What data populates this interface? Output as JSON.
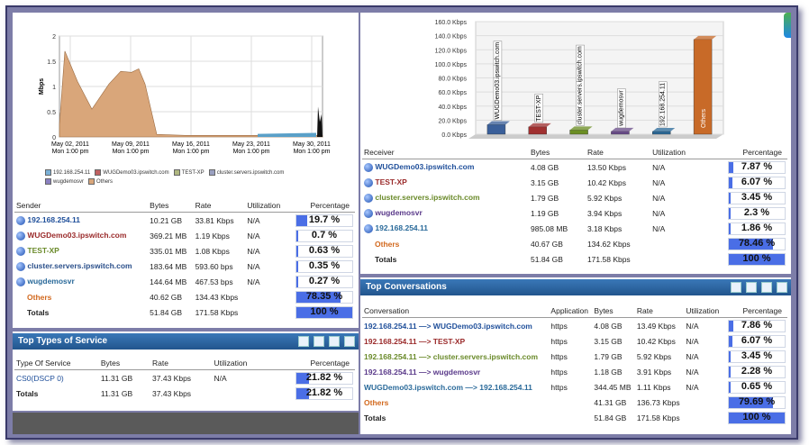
{
  "colors": {
    "header_blue": "#2a64a0",
    "bar_blue": "#4a6ee6",
    "others_orange": "#d2691e",
    "area_tan": "#d9a67a"
  },
  "sender_chart": {
    "y_ticks": [
      "2",
      "1.5",
      "1",
      "0.5",
      "0"
    ],
    "y_label": "Mbps",
    "x_ticks": [
      {
        "line1": "May 02, 2011",
        "line2": "Mon 1:00 pm"
      },
      {
        "line1": "May 09, 2011",
        "line2": "Mon 1:00 pm"
      },
      {
        "line1": "May 16, 2011",
        "line2": "Mon 1:00 pm"
      },
      {
        "line1": "May 23, 2011",
        "line2": "Mon 1:00 pm"
      },
      {
        "line1": "May 30, 2011",
        "line2": "Mon 1:00 pm"
      }
    ],
    "legend": [
      "192.168.254.11",
      "WUGDemo03.ipswitch.com",
      "TEST-XP",
      "cluster.servers.ipswitch.com",
      "wugdemosvr",
      "Others"
    ]
  },
  "sender_table": {
    "headers": [
      "Sender",
      "Bytes",
      "Rate",
      "Utilization",
      "Percentage"
    ],
    "rows": [
      {
        "name": "192.168.254.11",
        "bytes": "10.21 GB",
        "rate": "33.81 Kbps",
        "util": "N/A",
        "pct": "19.7 %",
        "frac": 0.197,
        "color": "#1f4f9a"
      },
      {
        "name": "WUGDemo03.ipswitch.com",
        "bytes": "369.21 MB",
        "rate": "1.19 Kbps",
        "util": "N/A",
        "pct": "0.7 %",
        "frac": 0.007,
        "color": "#9a2a2a"
      },
      {
        "name": "TEST-XP",
        "bytes": "335.01 MB",
        "rate": "1.08 Kbps",
        "util": "N/A",
        "pct": "0.63 %",
        "frac": 0.0063,
        "color": "#6a8a2a"
      },
      {
        "name": "cluster.servers.ipswitch.com",
        "bytes": "183.64 MB",
        "rate": "593.60 bps",
        "util": "N/A",
        "pct": "0.35 %",
        "frac": 0.0035,
        "color": "#2a4f8a"
      },
      {
        "name": "wugdemosvr",
        "bytes": "144.64 MB",
        "rate": "467.53 bps",
        "util": "N/A",
        "pct": "0.27 %",
        "frac": 0.0027,
        "color": "#2a6a9a"
      }
    ],
    "others": {
      "name": "Others",
      "bytes": "40.62 GB",
      "rate": "134.43 Kbps",
      "util": "N/A",
      "pct": "78.35 %",
      "frac": 0.7835
    },
    "totals": {
      "name": "Totals",
      "bytes": "51.84 GB",
      "rate": "171.58 Kbps",
      "util": "N/A",
      "pct": "100 %",
      "frac": 1.0
    }
  },
  "tos": {
    "title": "Top Types of Service",
    "headers": [
      "Type Of Service",
      "Bytes",
      "Rate",
      "Utilization",
      "Percentage"
    ],
    "row": {
      "name": "CS0(DSCP 0)",
      "bytes": "11.31 GB",
      "rate": "37.43 Kbps",
      "util": "N/A",
      "pct": "21.82 %",
      "frac": 0.2182
    },
    "totals": {
      "name": "Totals",
      "bytes": "11.31 GB",
      "rate": "37.43 Kbps",
      "util": "N/A",
      "pct": "21.82 %",
      "frac": 0.2182
    }
  },
  "receiver_chart": {
    "y_ticks": [
      "160.0 Kbps",
      "140.0 Kbps",
      "120.0 Kbps",
      "100.0 Kbps",
      "80.0 Kbps",
      "60.0 Kbps",
      "40.0 Kbps",
      "20.0 Kbps",
      "0.0 Kbps"
    ],
    "bars": [
      {
        "label": "WUGDemo03.ipswitch.com",
        "value": 13.5,
        "color": "#3a5f9a"
      },
      {
        "label": "TEST-XP",
        "value": 10.42,
        "color": "#a03030"
      },
      {
        "label": "cluster.servers.ipswitch.com",
        "value": 5.92,
        "color": "#6b8e23"
      },
      {
        "label": "wugdemosvr",
        "value": 3.94,
        "color": "#6a4c8a"
      },
      {
        "label": "192.168.254.11",
        "value": 3.18,
        "color": "#2a6a9a"
      },
      {
        "label": "Others",
        "value": 134.62,
        "color": "#c86a28"
      }
    ],
    "ymax": 160
  },
  "receiver_table": {
    "headers": [
      "Receiver",
      "Bytes",
      "Rate",
      "Utilization",
      "Percentage"
    ],
    "rows": [
      {
        "name": "WUGDemo03.ipswitch.com",
        "bytes": "4.08 GB",
        "rate": "13.50 Kbps",
        "util": "N/A",
        "pct": "7.87 %",
        "frac": 0.0787,
        "color": "#1f4f9a"
      },
      {
        "name": "TEST-XP",
        "bytes": "3.15 GB",
        "rate": "10.42 Kbps",
        "util": "N/A",
        "pct": "6.07 %",
        "frac": 0.0607,
        "color": "#9a2a2a"
      },
      {
        "name": "cluster.servers.ipswitch.com",
        "bytes": "1.79 GB",
        "rate": "5.92 Kbps",
        "util": "N/A",
        "pct": "3.45 %",
        "frac": 0.0345,
        "color": "#6a8a2a"
      },
      {
        "name": "wugdemosvr",
        "bytes": "1.19 GB",
        "rate": "3.94 Kbps",
        "util": "N/A",
        "pct": "2.3 %",
        "frac": 0.023,
        "color": "#5a3a8a"
      },
      {
        "name": "192.168.254.11",
        "bytes": "985.08 MB",
        "rate": "3.18 Kbps",
        "util": "N/A",
        "pct": "1.86 %",
        "frac": 0.0186,
        "color": "#2a6a9a"
      }
    ],
    "others": {
      "name": "Others",
      "bytes": "40.67 GB",
      "rate": "134.62 Kbps",
      "util": "N/A",
      "pct": "78.46 %",
      "frac": 0.7846
    },
    "totals": {
      "name": "Totals",
      "bytes": "51.84 GB",
      "rate": "171.58 Kbps",
      "util": "N/A",
      "pct": "100 %",
      "frac": 1.0
    }
  },
  "conversations": {
    "title": "Top Conversations",
    "headers": [
      "Conversation",
      "Application",
      "Bytes",
      "Rate",
      "Utilization",
      "Percentage"
    ],
    "rows": [
      {
        "name": "192.168.254.11 —> WUGDemo03.ipswitch.com",
        "app": "https",
        "bytes": "4.08 GB",
        "rate": "13.49 Kbps",
        "util": "N/A",
        "pct": "7.86 %",
        "frac": 0.0786,
        "color": "#1f4f9a"
      },
      {
        "name": "192.168.254.11 —> TEST-XP",
        "app": "https",
        "bytes": "3.15 GB",
        "rate": "10.42 Kbps",
        "util": "N/A",
        "pct": "6.07 %",
        "frac": 0.0607,
        "color": "#9a2a2a"
      },
      {
        "name": "192.168.254.11 —> cluster.servers.ipswitch.com",
        "app": "https",
        "bytes": "1.79 GB",
        "rate": "5.92 Kbps",
        "util": "N/A",
        "pct": "3.45 %",
        "frac": 0.0345,
        "color": "#6a8a2a"
      },
      {
        "name": "192.168.254.11 —> wugdemosvr",
        "app": "https",
        "bytes": "1.18 GB",
        "rate": "3.91 Kbps",
        "util": "N/A",
        "pct": "2.28 %",
        "frac": 0.0228,
        "color": "#5a3a8a"
      },
      {
        "name": "WUGDemo03.ipswitch.com —> 192.168.254.11",
        "app": "https",
        "bytes": "344.45 MB",
        "rate": "1.11 Kbps",
        "util": "N/A",
        "pct": "0.65 %",
        "frac": 0.0065,
        "color": "#2a6a9a"
      }
    ],
    "others": {
      "name": "Others",
      "bytes": "41.31 GB",
      "rate": "136.73 Kbps",
      "util": "N/A",
      "pct": "79.69 %",
      "frac": 0.7969
    },
    "totals": {
      "name": "Totals",
      "bytes": "51.84 GB",
      "rate": "171.58 Kbps",
      "util": "N/A",
      "pct": "100 %",
      "frac": 1.0
    }
  }
}
